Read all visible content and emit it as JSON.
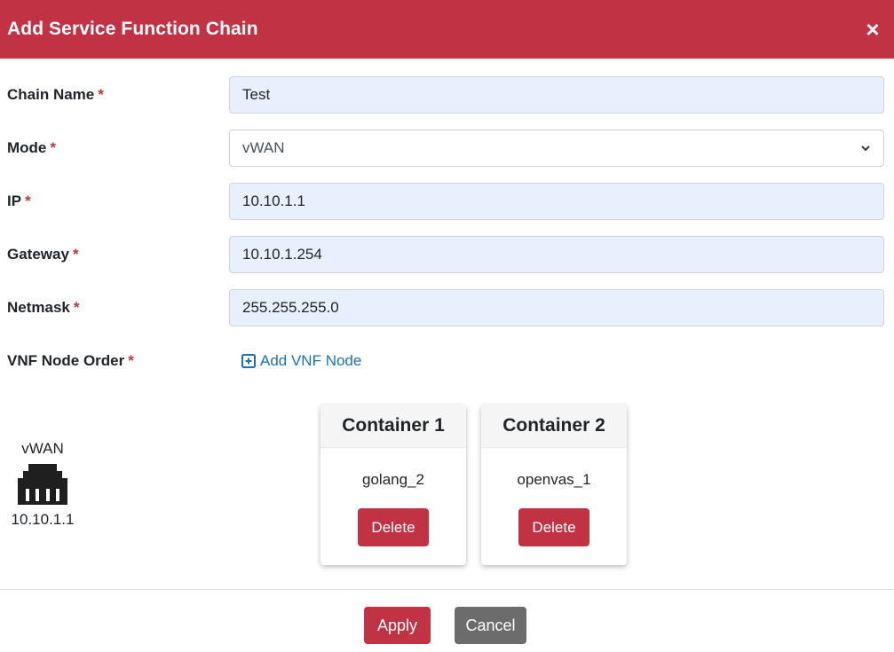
{
  "modal": {
    "title": "Add Service Function Chain",
    "close_symbol": "×"
  },
  "form": {
    "required_marker": "*",
    "chain_name": {
      "label": "Chain Name",
      "value": "Test"
    },
    "mode": {
      "label": "Mode",
      "selected": "vWAN"
    },
    "ip": {
      "label": "IP",
      "value": "10.10.1.1"
    },
    "gateway": {
      "label": "Gateway",
      "value": "10.10.1.254"
    },
    "netmask": {
      "label": "Netmask",
      "value": "255.255.255.0"
    },
    "vnf_node_order": {
      "label": "VNF Node Order",
      "add_link": "Add VNF Node"
    }
  },
  "topology": {
    "source": {
      "name": "vWAN",
      "ip": "10.10.1.1",
      "icon": "ethernet-port-icon"
    },
    "containers": [
      {
        "title": "Container 1",
        "name": "golang_2",
        "delete_label": "Delete"
      },
      {
        "title": "Container 2",
        "name": "openvas_1",
        "delete_label": "Delete"
      }
    ]
  },
  "footer": {
    "apply_label": "Apply",
    "cancel_label": "Cancel"
  },
  "colors": {
    "accent": "#c13344",
    "link": "#1a73b8",
    "input_bg": "#e8f0fe",
    "cancel": "#6c6c6c"
  }
}
